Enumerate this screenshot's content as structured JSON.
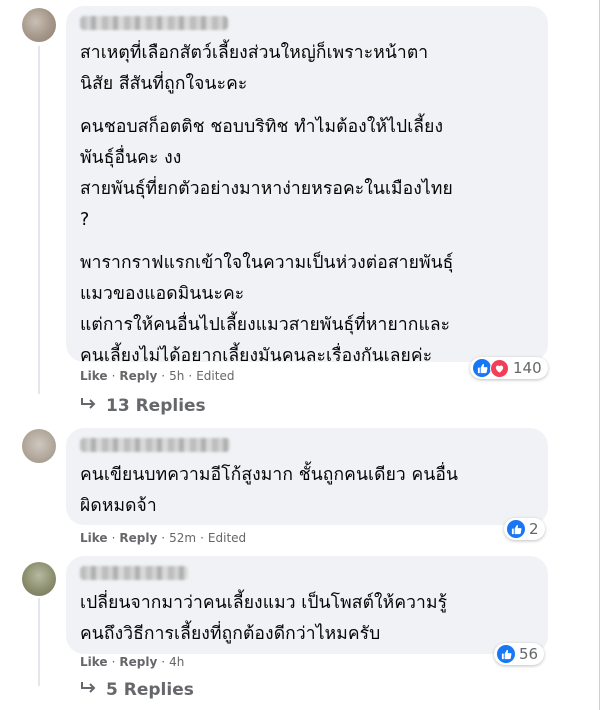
{
  "comments": [
    {
      "paragraphs": [
        "สาเหตุที่เลือกสัตว์เลี้ยงส่วนใหญ่ก็เพราะหน้าตา\nนิสัย สีสันที่ถูกใจนะคะ",
        "คนชอบสก็อตติช ชอบบริทิช ทำไมต้องให้ไปเลี้ยง\nพันธุ์อื่นคะ งง\nสายพันธุ์ที่ยกตัวอย่างมาหาง่ายหรอคะในเมืองไทย\n?",
        "พารากราฟแรกเข้าใจในความเป็นห่วงต่อสายพันธุ์\nแมวของแอดมินนะคะ\nแต่การให้คนอื่นไปเลี้ยงแมวสายพันธุ์ที่หายากและ\nคนเลี้ยงไม่ได้อยากเลี้ยงมันคนละเรื่องกันเลยค่ะ"
      ],
      "like_label": "Like",
      "reply_label": "Reply",
      "time": "5h",
      "edited": "Edited",
      "reaction_count": "140",
      "reaction_icons": [
        "like-icon",
        "love-icon"
      ]
    },
    {
      "paragraphs": [
        "คนเขียนบทความอีโก้สูงมาก ชั้นถูกคนเดียว คนอื่น\nผิดหมดจ้า"
      ],
      "like_label": "Like",
      "reply_label": "Reply",
      "time": "52m",
      "edited": "Edited",
      "reaction_count": "2",
      "reaction_icons": [
        "like-icon"
      ]
    },
    {
      "paragraphs": [
        "เปลี่ยนจากมาว่าคนเลี้ยงแมว เป็นโพสต์ให้ความรู้\nคนถึงวิธีการเลี้ยงที่ถูกต้องดีกว่าไหมครับ"
      ],
      "like_label": "Like",
      "reply_label": "Reply",
      "time": "4h",
      "reaction_count": "56",
      "reaction_icons": [
        "like-icon"
      ]
    }
  ],
  "replies_1": "13 Replies",
  "replies_3": "5 Replies",
  "separator": "·",
  "colors": {
    "bubble": "#f0f2f5",
    "meta": "#65676b",
    "like": "#1877f2",
    "love": "#f33e58"
  }
}
